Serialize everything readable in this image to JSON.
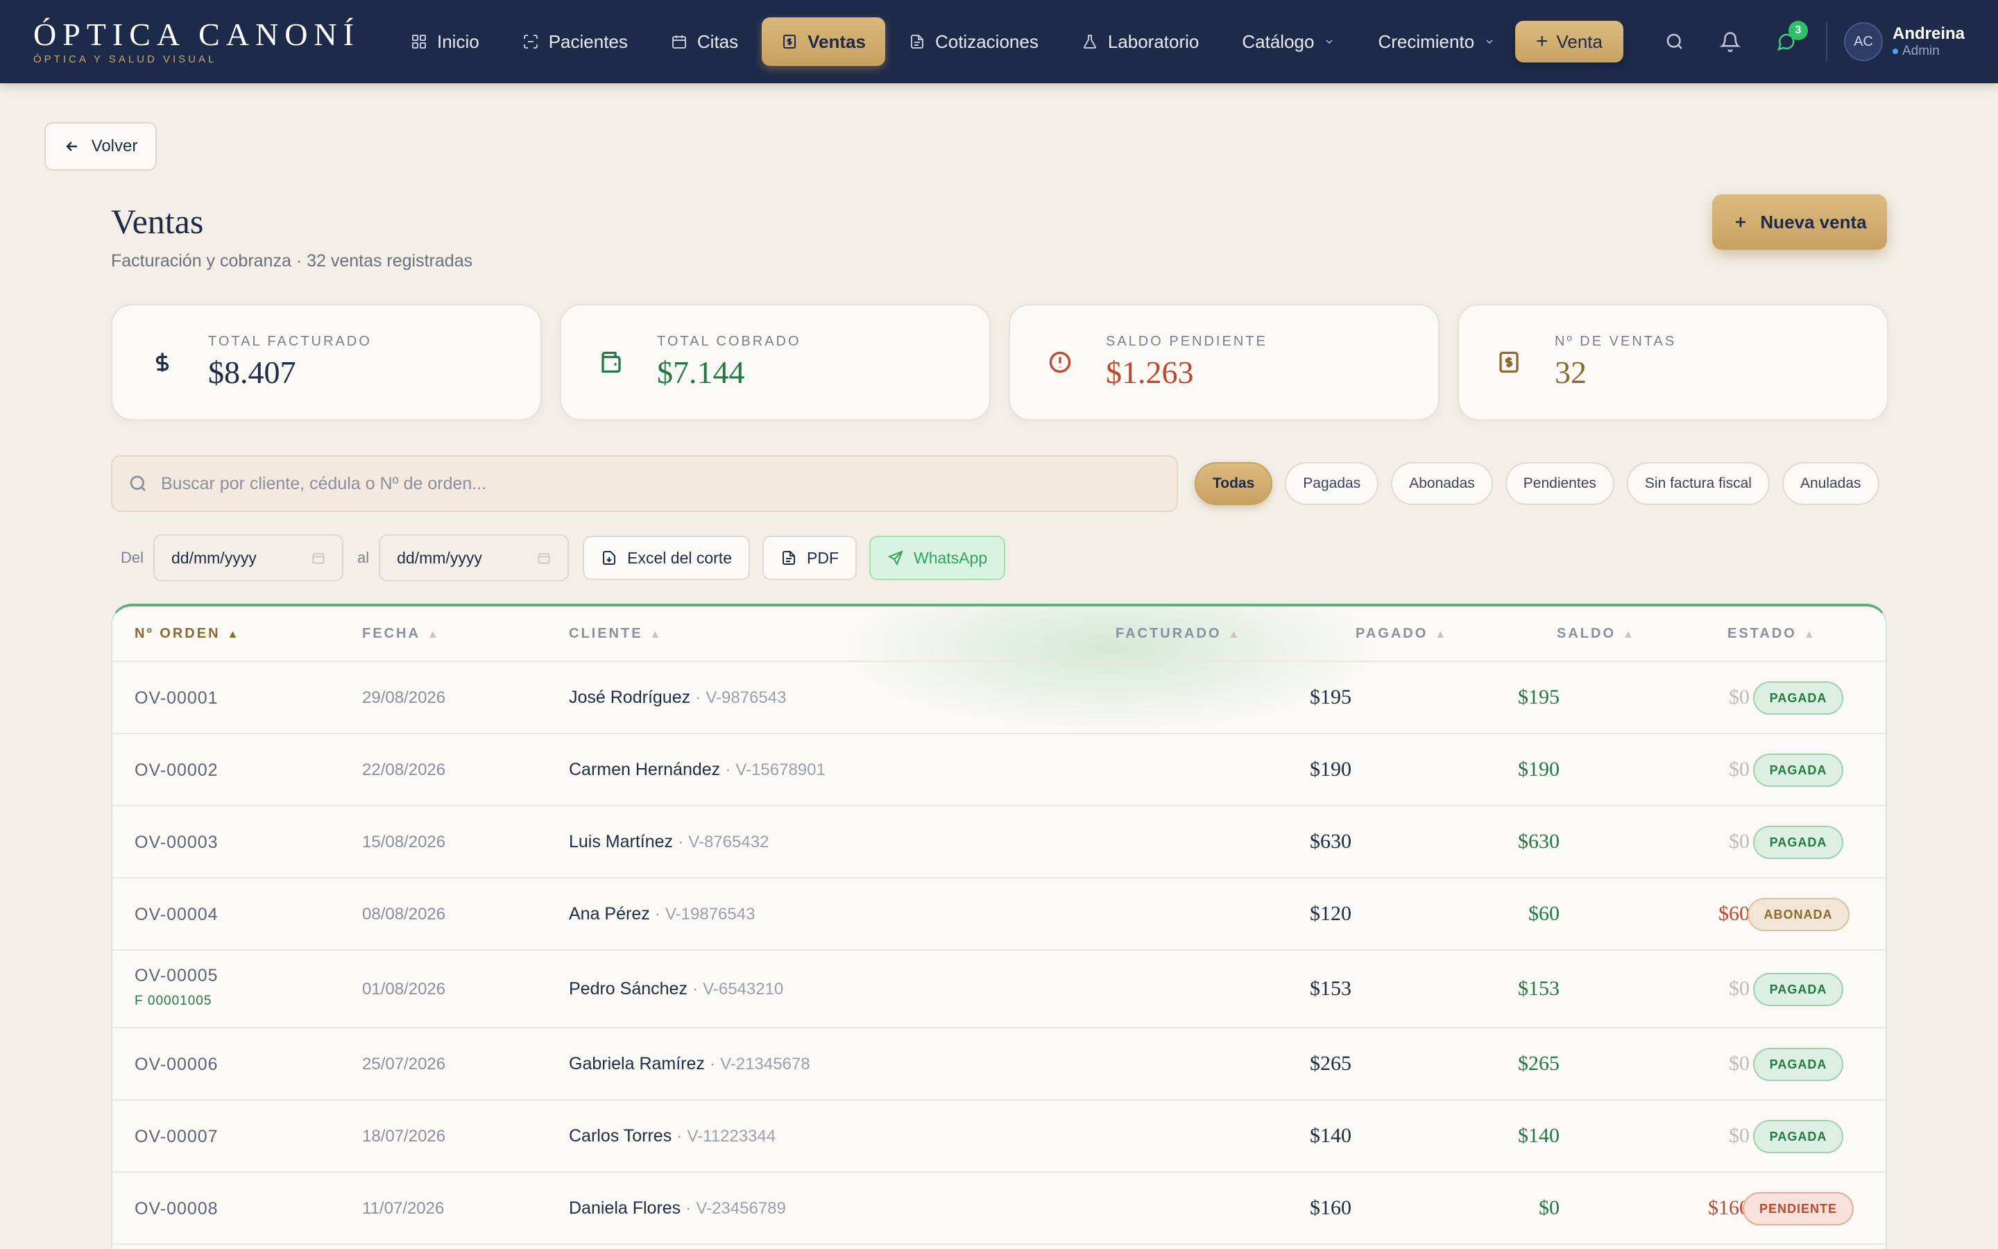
{
  "brand": {
    "name": "ÓPTICA CANONÍ",
    "tagline": "ÓPTICA Y SALUD VISUAL"
  },
  "nav": {
    "items": [
      {
        "label": "Inicio",
        "icon": "grid-icon",
        "active": false
      },
      {
        "label": "Pacientes",
        "icon": "scan-icon",
        "active": false
      },
      {
        "label": "Citas",
        "icon": "calendar-icon",
        "active": false
      },
      {
        "label": "Ventas",
        "icon": "receipt-icon",
        "active": true
      },
      {
        "label": "Cotizaciones",
        "icon": "document-icon",
        "active": false
      },
      {
        "label": "Laboratorio",
        "icon": "flask-icon",
        "active": false
      },
      {
        "label": "Catálogo",
        "icon": "chevron-down-icon",
        "active": false
      },
      {
        "label": "Crecimiento",
        "icon": "chevron-down-icon",
        "active": false
      }
    ],
    "venta_button": "Venta",
    "chat_badge": "3",
    "user": {
      "initials": "AC",
      "name": "Andreina",
      "role": "Admin"
    }
  },
  "back_label": "Volver",
  "header": {
    "title": "Ventas",
    "subtitle": "Facturación y cobranza · 32 ventas registradas",
    "new_button": "Nueva venta"
  },
  "stats": [
    {
      "label": "TOTAL FACTURADO",
      "value": "$8.407",
      "color": "#1f2a44",
      "icon": "dollar-icon"
    },
    {
      "label": "TOTAL COBRADO",
      "value": "$7.144",
      "color": "#1f7a45",
      "icon": "wallet-icon"
    },
    {
      "label": "SALDO PENDIENTE",
      "value": "$1.263",
      "color": "#c0462c",
      "icon": "alert-circle-icon"
    },
    {
      "label": "Nº DE VENTAS",
      "value": "32",
      "color": "#8a6a2e",
      "icon": "receipt-icon"
    }
  ],
  "search": {
    "placeholder": "Buscar por cliente, cédula o Nº de orden...",
    "value": ""
  },
  "filters": [
    "Todas",
    "Pagadas",
    "Abonadas",
    "Pendientes",
    "Sin factura fiscal",
    "Anuladas"
  ],
  "active_filter": "Todas",
  "date_range": {
    "from_label": "Del",
    "from_value": "dd/mm/yyyy",
    "to_label": "al",
    "to_value": "dd/mm/yyyy"
  },
  "exports": {
    "excel": "Excel del corte",
    "pdf": "PDF",
    "whatsapp": "WhatsApp"
  },
  "table": {
    "headers": {
      "order": "Nº ORDEN",
      "date": "FECHA",
      "client": "CLIENTE",
      "billed": "FACTURADO",
      "paid": "PAGADO",
      "balance": "SALDO",
      "status": "ESTADO"
    },
    "rows": [
      {
        "order": "OV-00001",
        "invoice": "",
        "date": "29/08/2026",
        "client": "José Rodríguez",
        "id": "V-9876543",
        "billed": "$195",
        "paid": "$195",
        "balance": "$0",
        "status": "PAGADA",
        "status_kind": "pagada"
      },
      {
        "order": "OV-00002",
        "invoice": "",
        "date": "22/08/2026",
        "client": "Carmen Hernández",
        "id": "V-15678901",
        "billed": "$190",
        "paid": "$190",
        "balance": "$0",
        "status": "PAGADA",
        "status_kind": "pagada"
      },
      {
        "order": "OV-00003",
        "invoice": "",
        "date": "15/08/2026",
        "client": "Luis Martínez",
        "id": "V-8765432",
        "billed": "$630",
        "paid": "$630",
        "balance": "$0",
        "status": "PAGADA",
        "status_kind": "pagada"
      },
      {
        "order": "OV-00004",
        "invoice": "",
        "date": "08/08/2026",
        "client": "Ana Pérez",
        "id": "V-19876543",
        "billed": "$120",
        "paid": "$60",
        "balance": "$60",
        "status": "ABONADA",
        "status_kind": "abonada"
      },
      {
        "order": "OV-00005",
        "invoice": "F 00001005",
        "date": "01/08/2026",
        "client": "Pedro Sánchez",
        "id": "V-6543210",
        "billed": "$153",
        "paid": "$153",
        "balance": "$0",
        "status": "PAGADA",
        "status_kind": "pagada"
      },
      {
        "order": "OV-00006",
        "invoice": "",
        "date": "25/07/2026",
        "client": "Gabriela Ramírez",
        "id": "V-21345678",
        "billed": "$265",
        "paid": "$265",
        "balance": "$0",
        "status": "PAGADA",
        "status_kind": "pagada"
      },
      {
        "order": "OV-00007",
        "invoice": "",
        "date": "18/07/2026",
        "client": "Carlos Torres",
        "id": "V-11223344",
        "billed": "$140",
        "paid": "$140",
        "balance": "$0",
        "status": "PAGADA",
        "status_kind": "pagada"
      },
      {
        "order": "OV-00008",
        "invoice": "",
        "date": "11/07/2026",
        "client": "Daniela Flores",
        "id": "V-23456789",
        "billed": "$160",
        "paid": "$0",
        "balance": "$160",
        "status": "PENDIENTE",
        "status_kind": "pendiente"
      }
    ]
  }
}
